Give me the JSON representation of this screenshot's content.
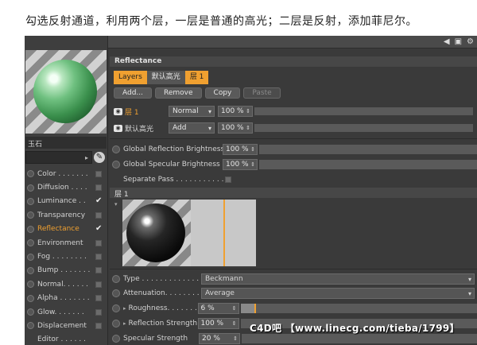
{
  "caption": "勾选反射通道，利用两个层，一层是普通的高光；二层是反射，添加菲尼尔。",
  "material": {
    "name": "玉石",
    "channels": [
      {
        "label": "Color . . . . . . .",
        "checked": false,
        "active": false
      },
      {
        "label": "Diffusion . . . .",
        "checked": false,
        "active": false
      },
      {
        "label": "Luminance . .",
        "checked": true,
        "active": false
      },
      {
        "label": "Transparency",
        "checked": false,
        "active": false
      },
      {
        "label": "Reflectance",
        "checked": true,
        "active": true
      },
      {
        "label": "Environment",
        "checked": false,
        "active": false
      },
      {
        "label": "Fog . . . . . . . .",
        "checked": false,
        "active": false
      },
      {
        "label": "Bump . . . . . . .",
        "checked": false,
        "active": false
      },
      {
        "label": "Normal. . . . . .",
        "checked": false,
        "active": false
      },
      {
        "label": "Alpha . . . . . . .",
        "checked": false,
        "active": false
      },
      {
        "label": "Glow. . . . . . .",
        "checked": false,
        "active": false
      },
      {
        "label": "Displacement",
        "checked": false,
        "active": false
      },
      {
        "label": "Editor . . . . . .",
        "checked": false,
        "active": false
      }
    ]
  },
  "reflectance": {
    "section_title": "Reflectance",
    "tabs": [
      "Layers",
      "默认高光",
      "层 1"
    ],
    "buttons": {
      "add": "Add...",
      "remove": "Remove",
      "copy": "Copy",
      "paste": "Paste"
    },
    "layers": [
      {
        "name": "层 1",
        "mode": "Normal",
        "percent": "100 %"
      },
      {
        "name": "默认高光",
        "mode": "Add",
        "percent": "100 %"
      }
    ],
    "global_reflection_label": "Global Reflection Brightness",
    "global_reflection_value": "100 %",
    "global_specular_label": "Global Specular Brightness",
    "global_specular_value": "100 %",
    "separate_pass_label": "Separate Pass . . . . . . . . . . . .",
    "layer_section_title": "层 1",
    "type_label": "Type . . . . . . . . . . . . .",
    "type_value": "Beckmann",
    "attenuation_label": "Attenuation. . . . . . . . .",
    "attenuation_value": "Average",
    "roughness_label": "Roughness. . . . . . . .",
    "roughness_value": "6 %",
    "reflection_strength_label": "Reflection Strength",
    "reflection_strength_value": "100 %",
    "specular_strength_label": "Specular Strength",
    "specular_strength_value": "20 %"
  },
  "watermark": "C4D吧 【www.linecg.com/tieba/1799】",
  "icons": [
    "arrow-left-icon",
    "lock-icon",
    "settings-icon"
  ],
  "colors": {
    "accent": "#f0a030",
    "panel": "#3a3a3a"
  }
}
